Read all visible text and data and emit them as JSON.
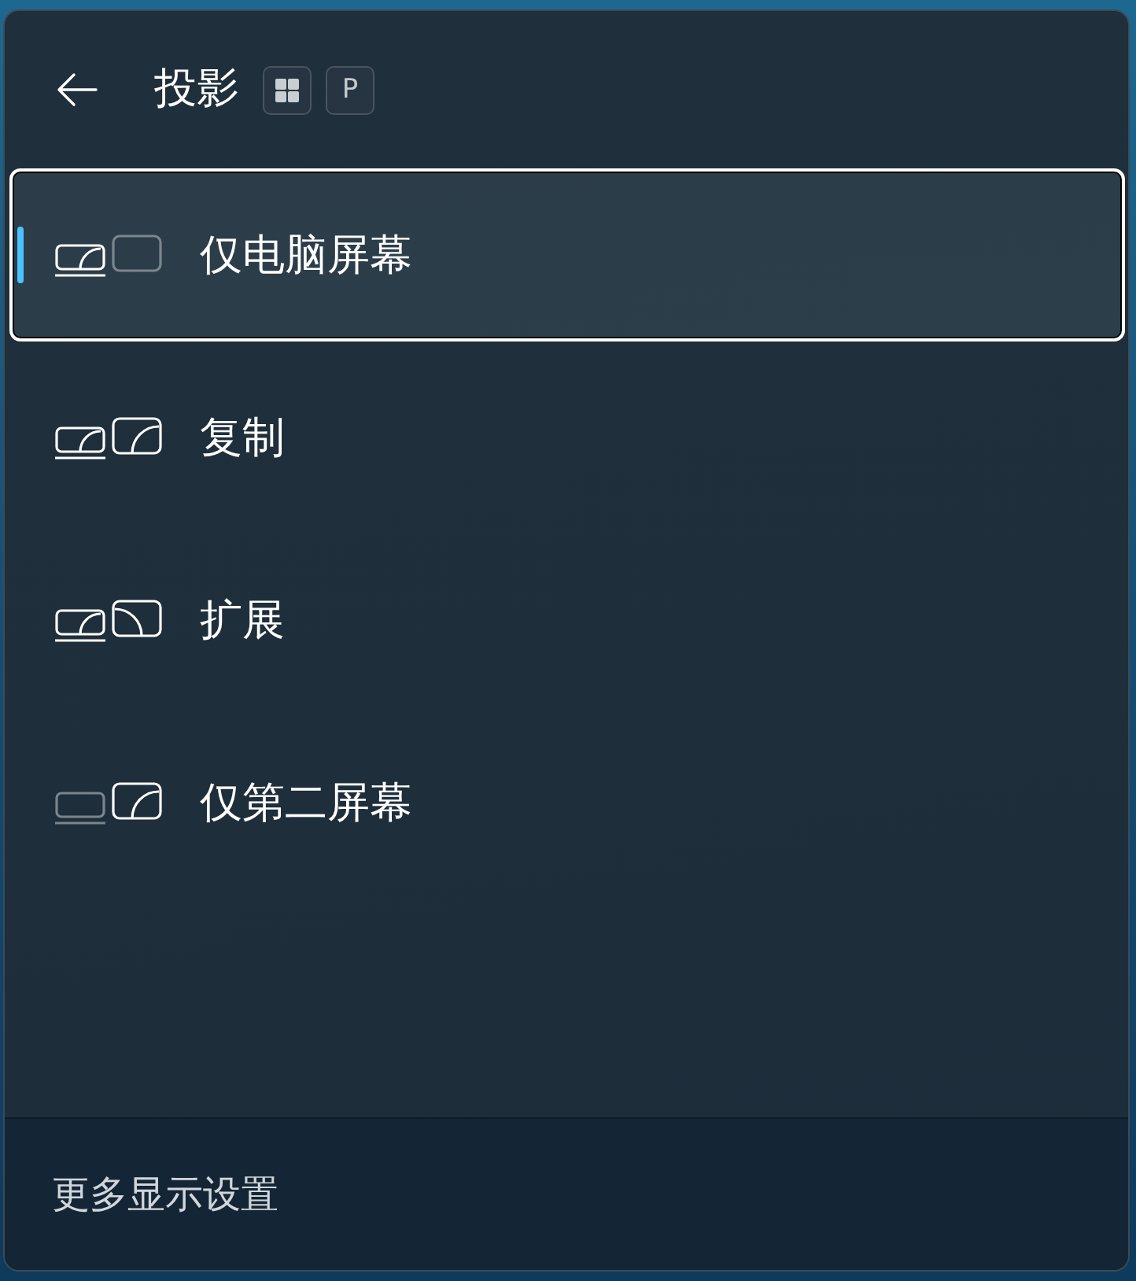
{
  "header": {
    "title": "投影",
    "keys": [
      {
        "kind": "windows-logo"
      },
      {
        "kind": "letter",
        "label": "P"
      }
    ]
  },
  "options": [
    {
      "kind": "pc-only",
      "label": "仅电脑屏幕",
      "selected": true
    },
    {
      "kind": "duplicate",
      "label": "复制",
      "selected": false
    },
    {
      "kind": "extend",
      "label": "扩展",
      "selected": false
    },
    {
      "kind": "second-only",
      "label": "仅第二屏幕",
      "selected": false
    }
  ],
  "footer": {
    "link": "更多显示设置"
  }
}
